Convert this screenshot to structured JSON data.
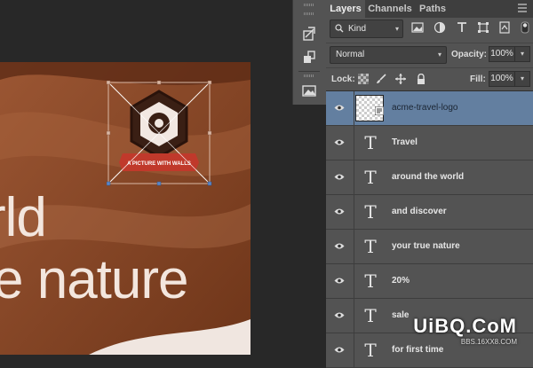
{
  "canvas": {
    "text_line_1": "rld",
    "text_line_2": "e nature",
    "logo_banner": "A PICTURE WITH WALLS"
  },
  "panel": {
    "tabs": [
      {
        "label": "Layers",
        "active": true
      },
      {
        "label": "Channels",
        "active": false
      },
      {
        "label": "Paths",
        "active": false
      }
    ],
    "filter": {
      "kind_label": "Kind"
    },
    "blend_mode": "Normal",
    "opacity_label": "Opacity:",
    "opacity_value": "100%",
    "lock_label": "Lock:",
    "fill_label": "Fill:",
    "fill_value": "100%",
    "layers": [
      {
        "name": "acme-travel-logo",
        "type": "smart-object",
        "selected": true
      },
      {
        "name": "Travel",
        "type": "text",
        "selected": false
      },
      {
        "name": "around the world",
        "type": "text",
        "selected": false
      },
      {
        "name": "and discover",
        "type": "text",
        "selected": false
      },
      {
        "name": "your true nature",
        "type": "text",
        "selected": false
      },
      {
        "name": "20%",
        "type": "text",
        "selected": false
      },
      {
        "name": "sale",
        "type": "text",
        "selected": false
      },
      {
        "name": "for first time",
        "type": "text",
        "selected": false
      }
    ]
  },
  "watermark": {
    "main": "UiBQ.CoM",
    "sub": "BBS.16XX8.COM"
  },
  "colors": {
    "selected_layer": "#637fa0",
    "canvas_brown": "#8a4a2b",
    "logo_dark": "#3a1f14",
    "ribbon_red": "#c0392b",
    "handle_blue": "#5b87c9"
  }
}
